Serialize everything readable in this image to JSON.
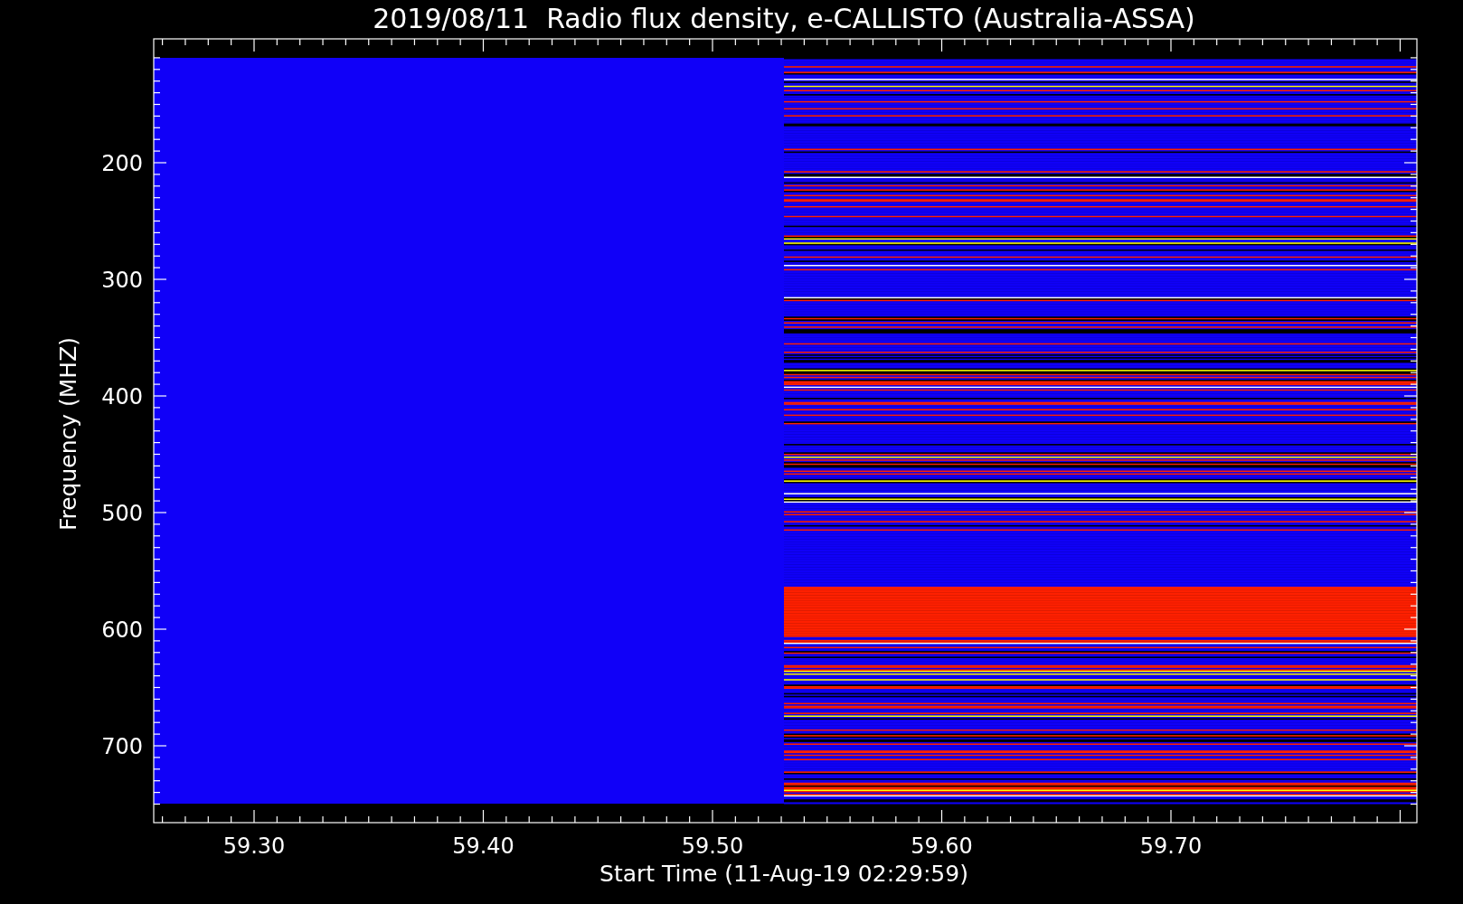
{
  "title": "2019/08/11  Radio flux density, e-CALLISTO (Australia-ASSA)",
  "xlabel": "Start Time (11-Aug-19 02:29:59)",
  "ylabel": "Frequency (MHZ)",
  "y_ticks": [
    "200",
    "300",
    "400",
    "500",
    "600",
    "700"
  ],
  "x_ticks": [
    "59.30",
    "59.40",
    "59.50",
    "59.60",
    "59.70"
  ]
}
